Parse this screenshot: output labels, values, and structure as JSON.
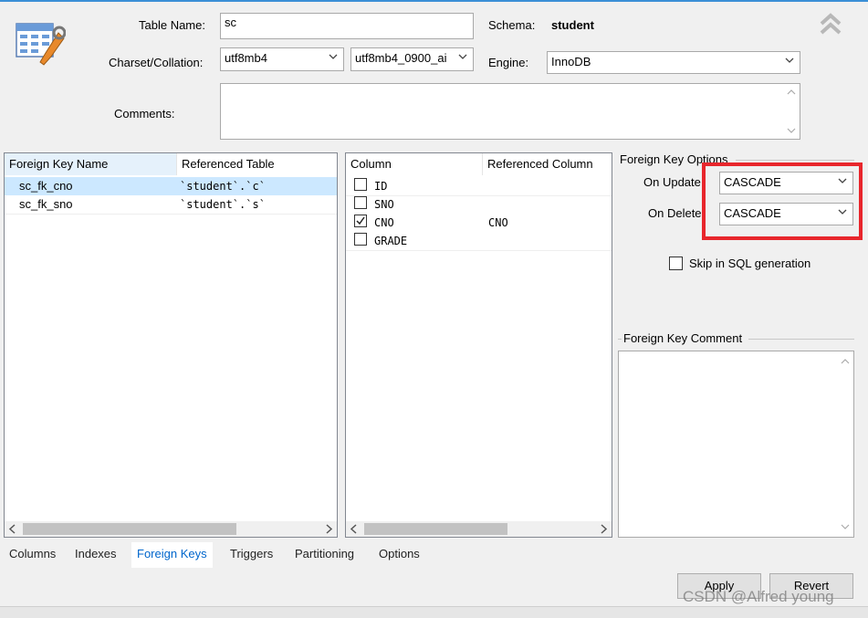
{
  "form": {
    "table_name_label": "Table Name:",
    "table_name_value": "sc",
    "schema_label": "Schema:",
    "schema_value": "student",
    "charset_label": "Charset/Collation:",
    "charset_value": "utf8mb4",
    "collation_value": "utf8mb4_0900_ai",
    "engine_label": "Engine:",
    "engine_value": "InnoDB",
    "comments_label": "Comments:"
  },
  "fk_grid": {
    "headers": [
      "Foreign Key Name",
      "Referenced Table"
    ],
    "rows": [
      {
        "name": "sc_fk_cno",
        "ref_table": "`student`.`c`"
      },
      {
        "name": "sc_fk_sno",
        "ref_table": "`student`.`s`"
      }
    ]
  },
  "col_grid": {
    "headers": [
      "Column",
      "Referenced Column"
    ],
    "rows": [
      {
        "column": "ID",
        "checked": false,
        "ref_column": ""
      },
      {
        "column": "SNO",
        "checked": false,
        "ref_column": ""
      },
      {
        "column": "CNO",
        "checked": true,
        "ref_column": "CNO"
      },
      {
        "column": "GRADE",
        "checked": false,
        "ref_column": ""
      }
    ]
  },
  "options": {
    "group_title": "Foreign Key Options",
    "on_update_label": "On Update",
    "on_update_value": "CASCADE",
    "on_delete_label": "On Delete",
    "on_delete_value": "CASCADE",
    "skip_sql_label": "Skip in SQL generation",
    "comment_group_title": "Foreign Key Comment"
  },
  "tabs": [
    "Columns",
    "Indexes",
    "Foreign Keys",
    "Triggers",
    "Partitioning",
    "Options"
  ],
  "active_tab": "Foreign Keys",
  "buttons": {
    "apply": "Apply",
    "revert": "Revert"
  },
  "watermark": "CSDN @Alfred young",
  "colors": {
    "highlight_box": "#e8262c",
    "selected_row": "#cce8ff",
    "active_tab": "#0066cc"
  }
}
